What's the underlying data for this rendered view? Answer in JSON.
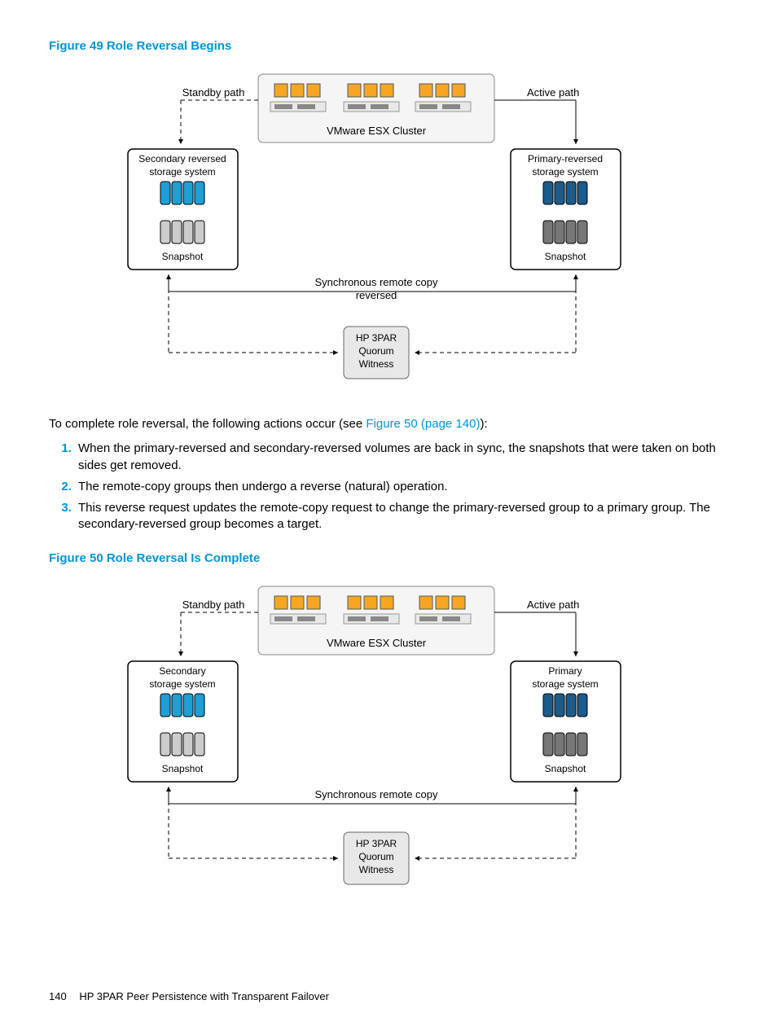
{
  "figure49": {
    "caption": "Figure 49 Role Reversal Begins",
    "standby_path": "Standby path",
    "active_path": "Active path",
    "cluster": "VMware ESX Cluster",
    "left_sys": "Secondary reversed storage system",
    "right_sys": "Primary-reversed storage system",
    "snapshot": "Snapshot",
    "sync_label_line1": "Synchronous remote copy",
    "sync_label_line2": "reversed",
    "witness_line1": "HP 3PAR",
    "witness_line2": "Quorum",
    "witness_line3": "Witness"
  },
  "intro_text_pre": "To complete role reversal, the following actions occur (see ",
  "intro_link": "Figure 50 (page 140)",
  "intro_text_post": "):",
  "steps": [
    "When the primary-reversed and secondary-reversed volumes are back in sync, the snapshots that were taken on both sides get removed.",
    "The remote-copy groups then undergo a reverse (natural) operation.",
    "This reverse request updates the remote-copy request to change the primary-reversed group to a primary group. The secondary-reversed group becomes a target."
  ],
  "figure50": {
    "caption": "Figure 50 Role Reversal Is Complete",
    "standby_path": "Standby path",
    "active_path": "Active path",
    "cluster": "VMware ESX Cluster",
    "left_sys": "Secondary storage system",
    "right_sys": "Primary storage system",
    "snapshot": "Snapshot",
    "sync_label": "Synchronous remote copy",
    "witness_line1": "HP 3PAR",
    "witness_line2": "Quorum",
    "witness_line3": "Witness"
  },
  "footer": {
    "page": "140",
    "title": "HP 3PAR Peer Persistence with Transparent Failover"
  }
}
